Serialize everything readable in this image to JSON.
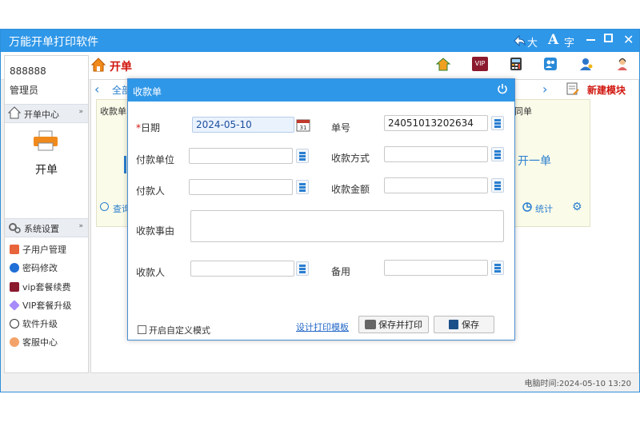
{
  "app": {
    "title": "万能开单打印软件",
    "font_large": "大",
    "font_char": "字"
  },
  "header": {
    "page_title": "开单"
  },
  "sidebar": {
    "account_id": "888888",
    "role": "管理员",
    "section1": "开单中心",
    "open_order_label": "开单",
    "section2": "系统设置",
    "items": [
      {
        "label": "子用户管理"
      },
      {
        "label": "密码修改"
      },
      {
        "label": "vip套餐续费"
      },
      {
        "label": "VIP套餐升级"
      },
      {
        "label": "软件升级"
      },
      {
        "label": "客服中心"
      }
    ]
  },
  "content": {
    "all_label": "全部",
    "new_module": "新建模块",
    "card_left_title": "收款单",
    "card_left_query": "查询",
    "card_right_title": "同单",
    "card_right_action": "开一单",
    "card_right_stats": "统计"
  },
  "dialog": {
    "title": "收款单",
    "date_label": "日期",
    "date_value": "2024-05-10",
    "order_no_label": "单号",
    "order_no_value": "24051013202634",
    "payer_unit_label": "付款单位",
    "payment_method_label": "收款方式",
    "payer_label": "付款人",
    "amount_label": "收款金额",
    "reason_label": "收款事由",
    "payee_label": "收款人",
    "remark_label": "备用",
    "custom_mode_label": "开启自定义模式",
    "design_template_label": "设计打印模板",
    "save_print_label": "保存并打印",
    "save_label": "保存"
  },
  "status": {
    "pc_time": "电脑时间:2024-05-10 13:20"
  }
}
